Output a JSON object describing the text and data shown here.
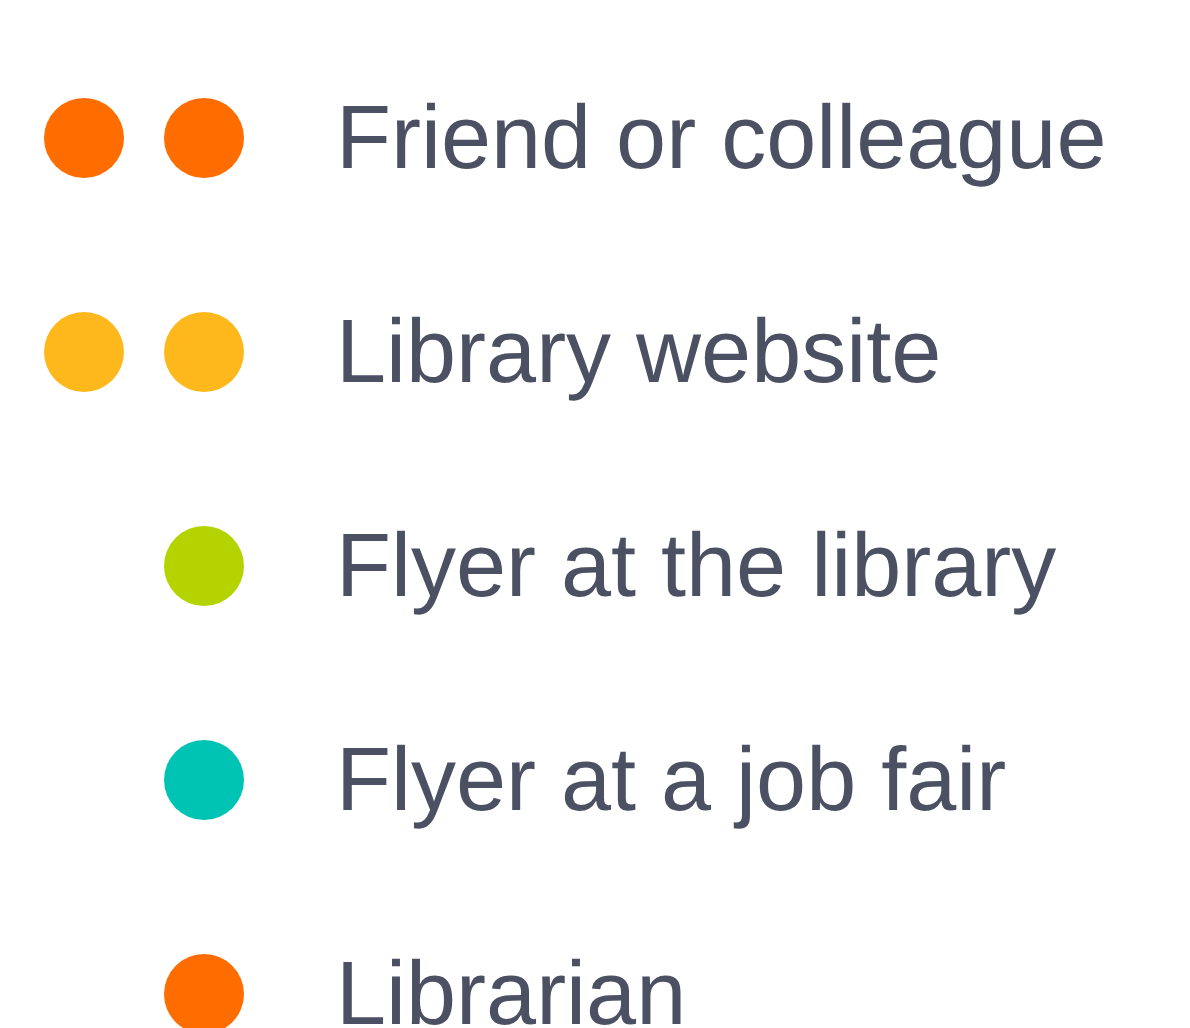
{
  "legend": {
    "items": [
      {
        "label": "Friend or colleague",
        "dots": [
          {
            "color": "#ff6d00"
          },
          {
            "color": "#ff6d00"
          }
        ]
      },
      {
        "label": "Library website",
        "dots": [
          {
            "color": "#ffb81c"
          },
          {
            "color": "#ffb81c"
          }
        ]
      },
      {
        "label": "Flyer at the library",
        "dots": [
          {
            "color": "#b5d300"
          }
        ]
      },
      {
        "label": "Flyer at a job fair",
        "dots": [
          {
            "color": "#00c4b3"
          }
        ]
      },
      {
        "label": "Librarian",
        "dots": [
          {
            "color": "#ff6d00"
          }
        ]
      }
    ]
  }
}
